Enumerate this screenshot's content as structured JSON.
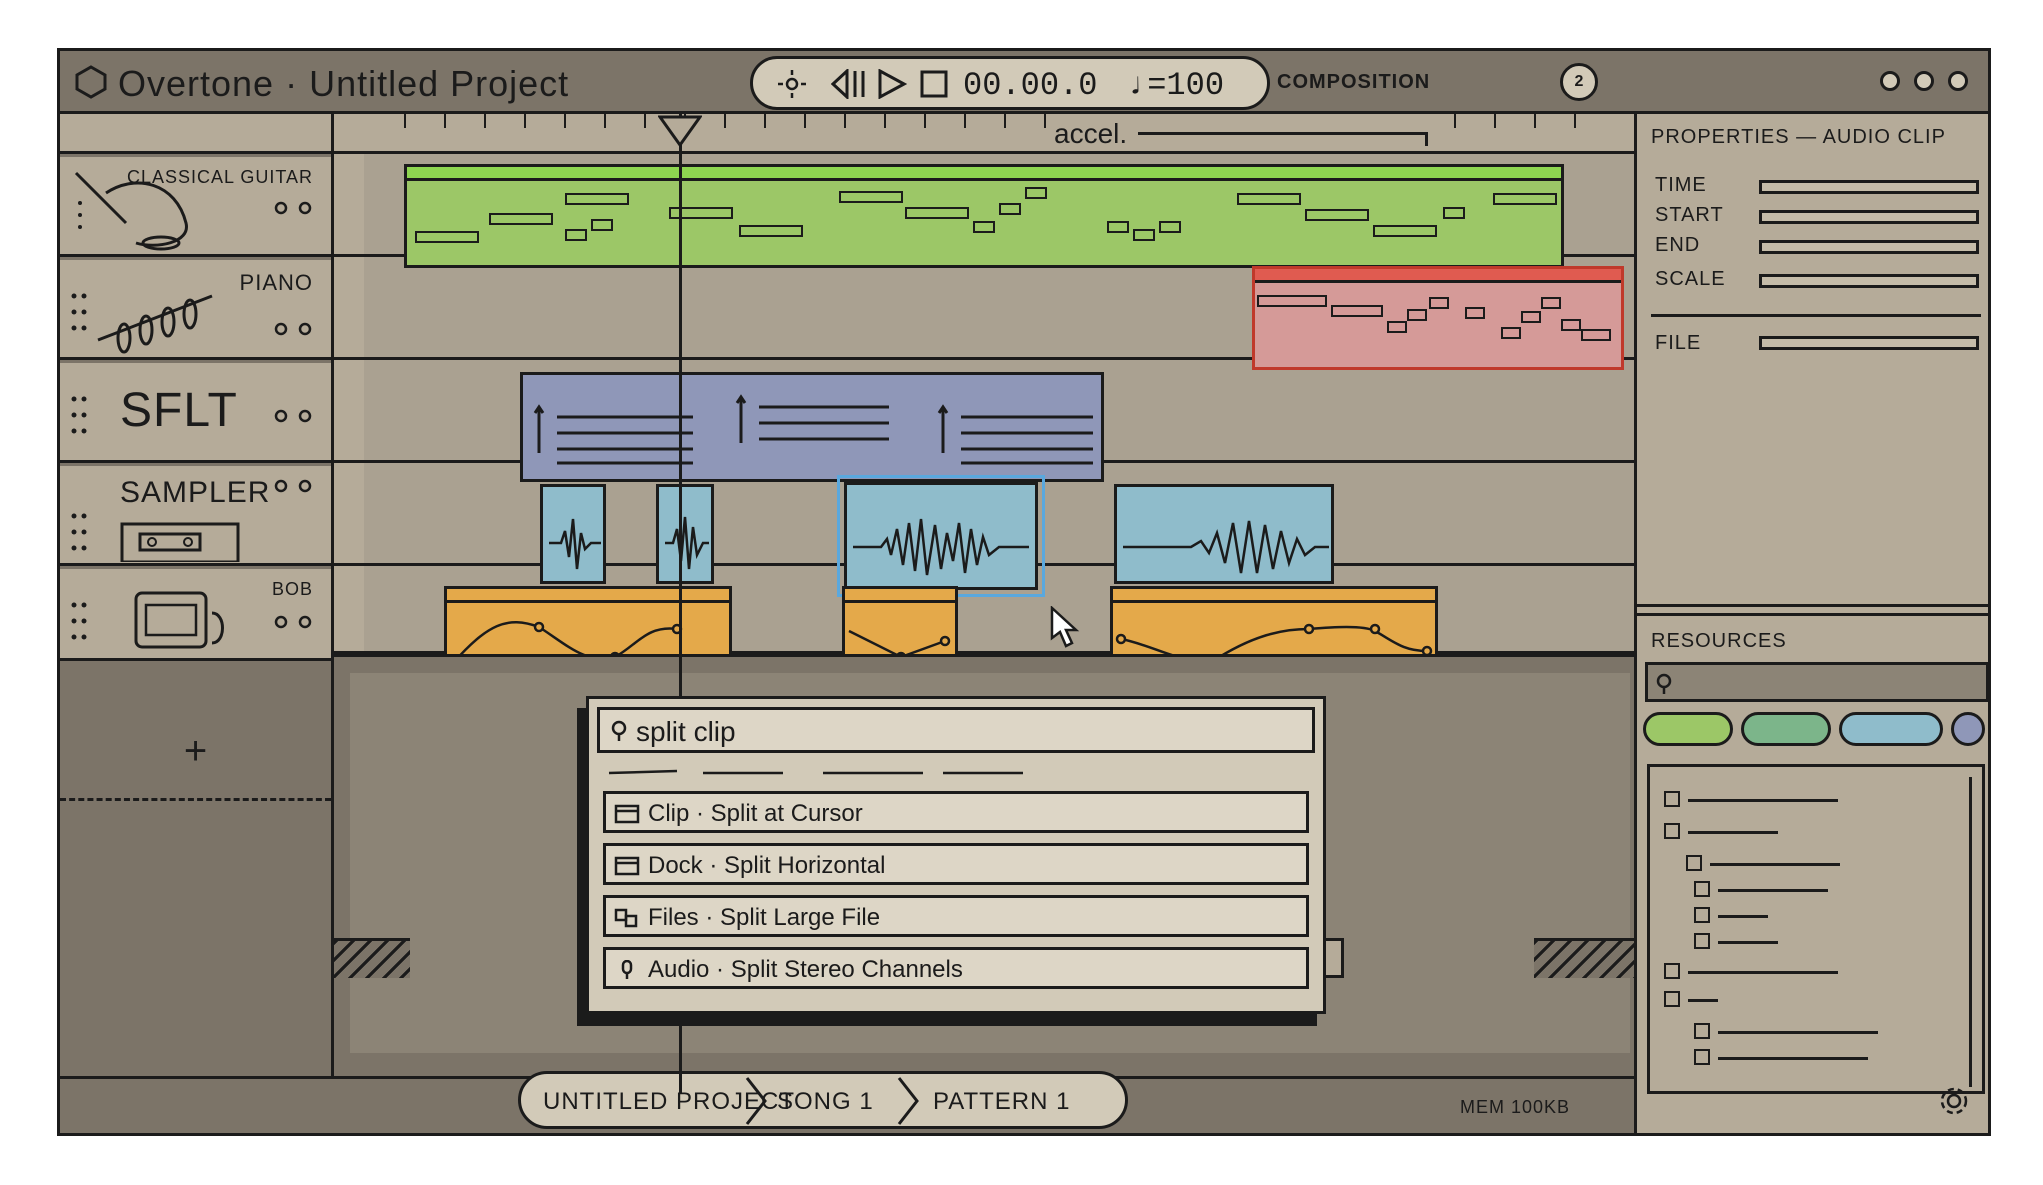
{
  "app": {
    "title": "Overtone · Untitled Project"
  },
  "transport": {
    "time": "00.00.0",
    "tempo": "♩=100"
  },
  "mode": {
    "label": "COMPOSITION"
  },
  "user": {
    "avatar_label": "2"
  },
  "tracks": [
    {
      "name": "CLASSICAL GUITAR"
    },
    {
      "name": "PIANO"
    },
    {
      "name": "SFLT"
    },
    {
      "name": "SAMPLER"
    },
    {
      "name": "BOB"
    }
  ],
  "add_track": {
    "label": "+"
  },
  "ruler": {
    "tempo_marker": "accel."
  },
  "clips": {
    "guitar": {
      "color": "#9cc767",
      "head": "#8ed650"
    },
    "red": {
      "color": "#d59a98",
      "head": "#e05b50"
    },
    "sflt": {
      "color": "#8f97b8"
    },
    "audio": {
      "color": "#8fbccb",
      "selected": "#5aa8de"
    },
    "automation": {
      "color": "#e4a94a"
    }
  },
  "palette": {
    "query": "split clip",
    "items": [
      {
        "icon": "window-icon",
        "label": "Clip · Split at Cursor"
      },
      {
        "icon": "window-icon",
        "label": "Dock · Split Horizontal"
      },
      {
        "icon": "files-icon",
        "label": "Files · Split Large File"
      },
      {
        "icon": "microphone-icon",
        "label": "Audio · Split Stereo Channels"
      }
    ]
  },
  "breadcrumb": [
    "UNTITLED PROJECT",
    "SONG 1",
    "PATTERN 1"
  ],
  "status": {
    "memory": "MEM 100KB"
  },
  "properties": {
    "title": "PROPERTIES — AUDIO CLIP",
    "fields": [
      {
        "label": "TIME"
      },
      {
        "label": "START"
      },
      {
        "label": "END"
      },
      {
        "label": "SCALE"
      },
      {
        "label": "FILE"
      }
    ]
  },
  "resources": {
    "title": "RESOURCES"
  }
}
